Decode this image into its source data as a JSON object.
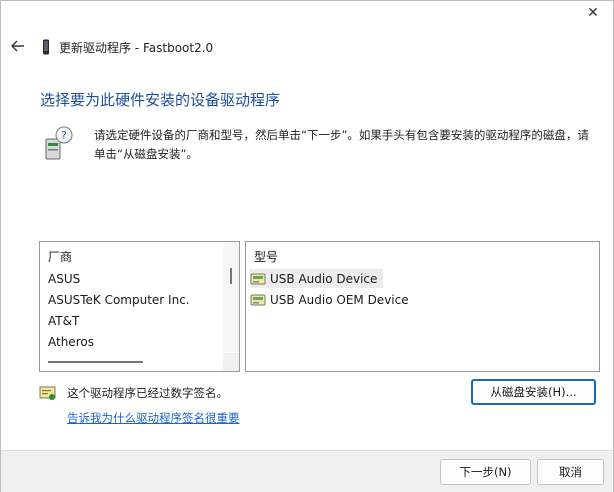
{
  "window": {
    "close_glyph": "✕",
    "title": "更新驱动程序 - Fastboot2.0"
  },
  "page": {
    "heading": "选择要为此硬件安装的设备驱动程序",
    "instruction": "请选定硬件设备的厂商和型号，然后单击“下一步”。如果手头有包含要安装的驱动程序的磁盘，请单击“从磁盘安装”。"
  },
  "manufacturer": {
    "header": "厂商",
    "items": [
      "ASUS",
      "ASUSTeK Computer Inc.",
      "AT&T",
      "Atheros"
    ]
  },
  "model": {
    "header": "型号",
    "items": [
      "USB Audio Device",
      "USB Audio OEM Device"
    ],
    "selected": "USB Audio Device"
  },
  "signature": {
    "text": "这个驱动程序已经过数字签名。",
    "link": "告诉我为什么驱动程序签名很重要"
  },
  "buttons": {
    "have_disk": "从磁盘安装(H)...",
    "next": "下一步(N)",
    "cancel": "取消"
  },
  "colors": {
    "accent": "#1a64c8",
    "heading": "#1c4f9c",
    "footer_bg": "#f0f0f0"
  },
  "icons": [
    "back-arrow-icon",
    "device-icon",
    "question-computer-icon",
    "driver-icon",
    "certificate-icon"
  ]
}
